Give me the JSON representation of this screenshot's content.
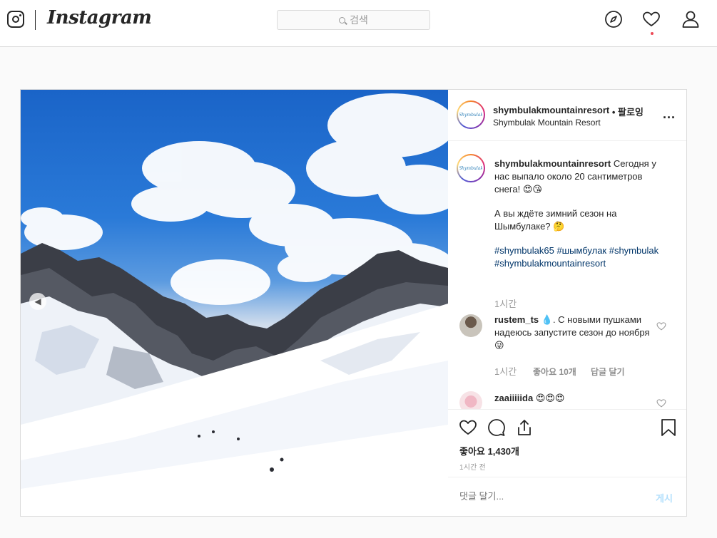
{
  "topbar": {
    "brand": "Instagram",
    "search_placeholder": "검색"
  },
  "post": {
    "username": "shymbulakmountainresort",
    "follow_label": "• 팔로잉",
    "location": "Shymbulak Mountain Resort",
    "avatar_text": "Shymbulak",
    "more_label": "...",
    "caption": {
      "username": "shymbulakmountainresort",
      "line1": "Сегодня у нас выпало около 20 сантиметров снега! 😍😘",
      "line2": "А вы ждёте зимний сезон на Шымбулаке? 🤔",
      "hashtags": "#shymbulak65 #шымбулак #shymbulak #shymbulakmountainresort",
      "time": "1시간"
    },
    "comments": [
      {
        "username": "rustem_ts",
        "text": "💧. С новыми пушками надеюсь запустите сезон до ноября 😜",
        "time": "1시간",
        "likes": "좋아요 10개",
        "reply": "답글 달기"
      },
      {
        "username": "zaaiiiiida",
        "text": "😍😍😍"
      }
    ],
    "likes": "좋아요 1,430개",
    "time_ago": "1시간 전",
    "comment_placeholder": "댓글 달기...",
    "post_button": "게시",
    "carousel": {
      "count": 6,
      "active_index": 5
    }
  },
  "colors": {
    "accent_blue": "#0095f6",
    "disabled_post": "#b2dffc",
    "hashtag": "#003569",
    "notif_dot": "#ed4956"
  },
  "icons": [
    "instagram-camera-icon",
    "search-icon",
    "compass-icon",
    "heart-icon",
    "profile-icon",
    "carousel-prev-icon",
    "like-icon",
    "comment-icon",
    "share-icon",
    "bookmark-icon",
    "more-icon"
  ]
}
